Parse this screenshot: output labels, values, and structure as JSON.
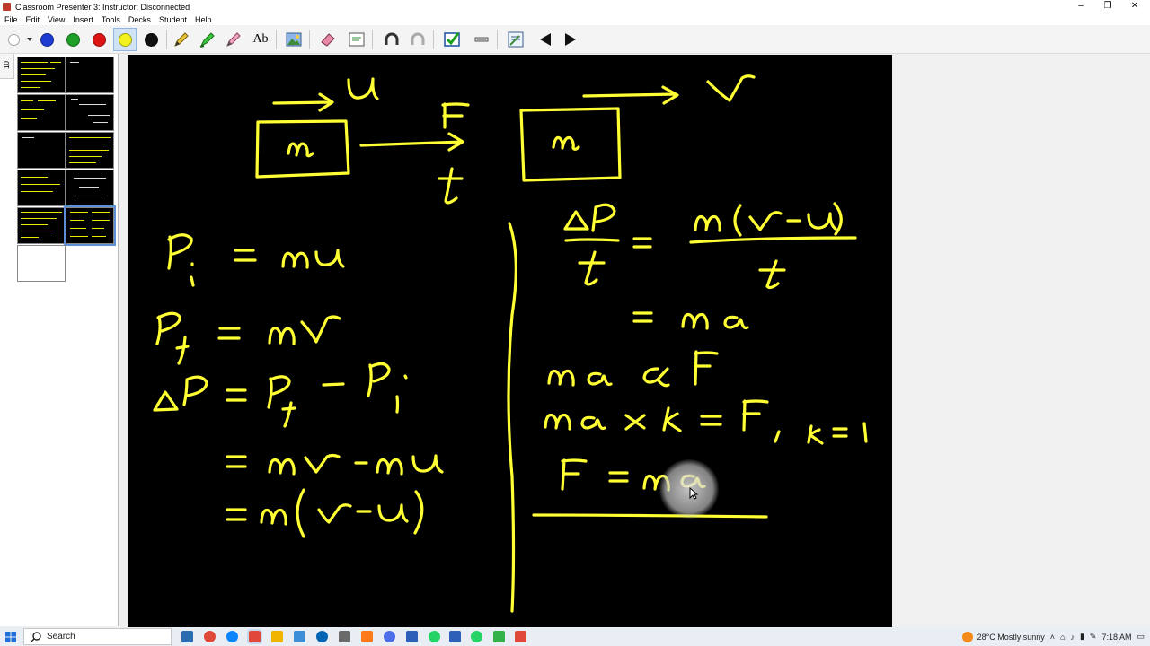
{
  "window": {
    "title": "Classroom Presenter 3: Instructor; Disconnected",
    "controls": [
      "–",
      "❐",
      "✕"
    ]
  },
  "menu": [
    "File",
    "Edit",
    "View",
    "Insert",
    "Tools",
    "Decks",
    "Student",
    "Help"
  ],
  "toolbar": {
    "pen_colors": [
      "#1e3cd2",
      "#1ea028",
      "#dc1414",
      "#f2f21e",
      "#111111"
    ],
    "selected_color": "#f2f21e",
    "text_tool_label": "Ab"
  },
  "filmstrip": {
    "tab_label": "10",
    "thumbnail_count": 11,
    "selected_index": 9
  },
  "slide": {
    "ink_color": "#ffff33",
    "handwriting": [
      "u",
      "m",
      "F",
      "t",
      "m",
      "v",
      "Pi = mu",
      "Pf = mv",
      "ΔP = Pf – Pi",
      "= mv – mu",
      "= m(v – u)",
      "ΔP / t = m(v – u) / t",
      "= ma",
      "ma ∝ F",
      "ma × k = F , k = 1",
      "F = ma"
    ]
  },
  "taskbar": {
    "search_placeholder": "Search",
    "app_icon_colors": [
      "#2b6cb0",
      "#e0493a",
      "#0a84ff",
      "#e0493a",
      "#f0b400",
      "#3a8fd8",
      "#0064b4",
      "#6a6a6a",
      "#ff7a1a",
      "#4c6ee8",
      "#2b5fb8",
      "#25d366",
      "#33b249",
      "#e0493a"
    ],
    "weather": "28°C  Mostly sunny",
    "time": "7:18 AM"
  }
}
